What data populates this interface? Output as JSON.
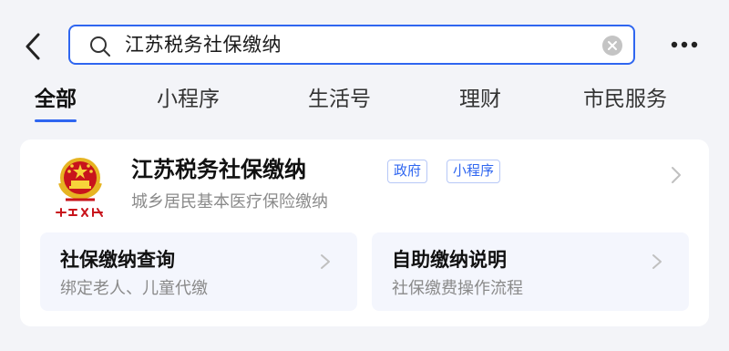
{
  "search": {
    "query": "江苏税务社保缴纳"
  },
  "tabs": [
    {
      "label": "全部",
      "active": true
    },
    {
      "label": "小程序",
      "active": false
    },
    {
      "label": "生活号",
      "active": false
    },
    {
      "label": "理财",
      "active": false
    },
    {
      "label": "市民服务",
      "active": false
    }
  ],
  "result": {
    "title": "江苏税务社保缴纳",
    "tags": [
      "政府",
      "小程序"
    ],
    "subtitle": "城乡居民基本医疗保险缴纳",
    "logo_text": "中国税务",
    "services": [
      {
        "title": "社保缴纳查询",
        "desc": "绑定老人、儿童代缴"
      },
      {
        "title": "自助缴纳说明",
        "desc": "社保缴费操作流程"
      }
    ]
  },
  "icons": {
    "back": "chevron-left-icon",
    "search": "search-icon",
    "clear": "clear-icon",
    "more": "more-icon"
  },
  "colors": {
    "accent": "#2f66f0",
    "background": "#f3f4f8",
    "card": "#ffffff",
    "sub_card": "#f4f6fd",
    "emblem_red": "#c8141c",
    "emblem_gold": "#e6b422"
  }
}
